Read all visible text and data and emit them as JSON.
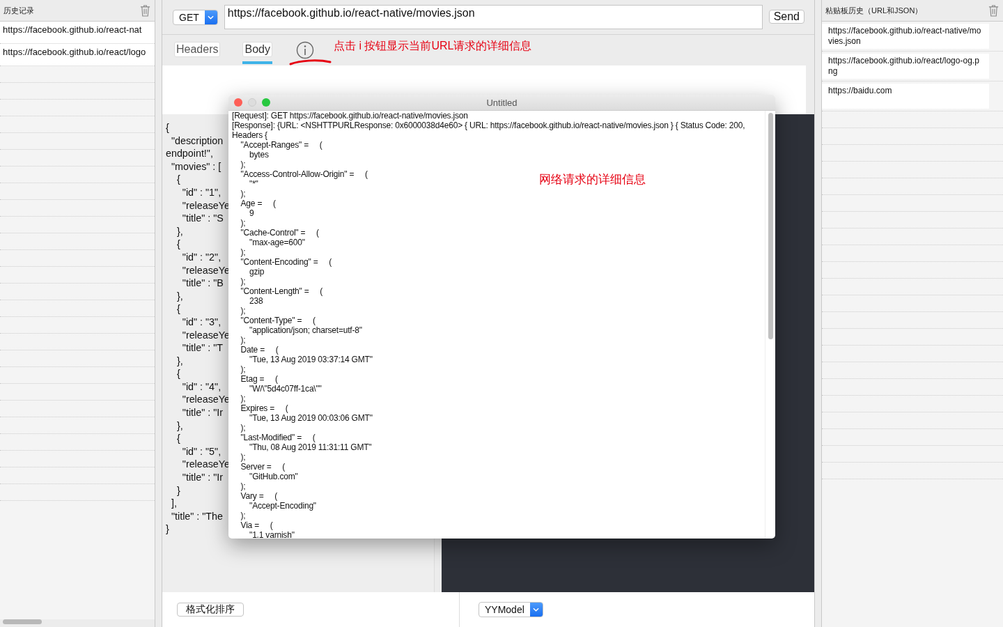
{
  "history": {
    "title": "历史记录",
    "items": [
      {
        "url": "https://facebook.github.io/react-nat",
        "selected": false
      },
      {
        "url": "https://facebook.github.io/react/logo",
        "selected": false
      }
    ]
  },
  "request": {
    "method": "GET",
    "url": "https://facebook.github.io/react-native/movies.json",
    "send": "Send"
  },
  "tabs": [
    {
      "label": "Headers",
      "selected": false
    },
    {
      "label": "Body",
      "selected": true
    }
  ],
  "hint": "点击 i 按钮显示当前URL请求的详细信息",
  "json_lines": [
    "{",
    "  \"description",
    "endpoint!\",",
    "  \"movies\" : [",
    "    {",
    "      \"id\" : \"1\",",
    "      \"releaseYe",
    "      \"title\" : \"S",
    "    },",
    "    {",
    "      \"id\" : \"2\",",
    "      \"releaseYe",
    "      \"title\" : \"B",
    "    },",
    "    {",
    "      \"id\" : \"3\",",
    "      \"releaseYe",
    "      \"title\" : \"T",
    "    },",
    "    {",
    "      \"id\" : \"4\",",
    "      \"releaseYe",
    "      \"title\" : \"Ir",
    "    },",
    "    {",
    "      \"id\" : \"5\",",
    "      \"releaseYe",
    "      \"title\" : \"Ir",
    "    }",
    "  ],",
    "  \"title\" : \"The",
    "}"
  ],
  "format_button": "格式化排序",
  "model_select": "YYModel",
  "clipboard": {
    "title": "粘贴板历史（URL和JSON）",
    "items": [
      {
        "text": "https://facebook.github.io/react-native/movies.json"
      },
      {
        "text": "https://facebook.github.io/react/logo-og.png"
      },
      {
        "text": "https://baidu.com"
      }
    ]
  },
  "detail_window": {
    "title": "Untitled",
    "note": "网络请求的详细信息",
    "lines": [
      "[Request]: GET https://facebook.github.io/react-native/movies.json",
      "[Response]: {URL: <NSHTTPURLResponse: 0x6000038d4e60> { URL: https://facebook.github.io/react-native/movies.json } { Status Code: 200, Headers {",
      "    \"Accept-Ranges\" =     (",
      "        bytes",
      "    );",
      "    \"Access-Control-Allow-Origin\" =     (",
      "        \"*\"",
      "    );",
      "    Age =     (",
      "        9",
      "    );",
      "    \"Cache-Control\" =     (",
      "        \"max-age=600\"",
      "    );",
      "    \"Content-Encoding\" =     (",
      "        gzip",
      "    );",
      "    \"Content-Length\" =     (",
      "        238",
      "    );",
      "    \"Content-Type\" =     (",
      "        \"application/json; charset=utf-8\"",
      "    );",
      "    Date =     (",
      "        \"Tue, 13 Aug 2019 03:37:14 GMT\"",
      "    );",
      "    Etag =     (",
      "        \"W/\\\"5d4c07ff-1ca\\\"\"",
      "    );",
      "    Expires =     (",
      "        \"Tue, 13 Aug 2019 00:03:06 GMT\"",
      "    );",
      "    \"Last-Modified\" =     (",
      "        \"Thu, 08 Aug 2019 11:31:11 GMT\"",
      "    );",
      "    Server =     (",
      "        \"GitHub.com\"",
      "    );",
      "    Vary =     (",
      "        \"Accept-Encoding\"",
      "    );",
      "    Via =     (",
      "        \"1.1 varnish\""
    ]
  }
}
